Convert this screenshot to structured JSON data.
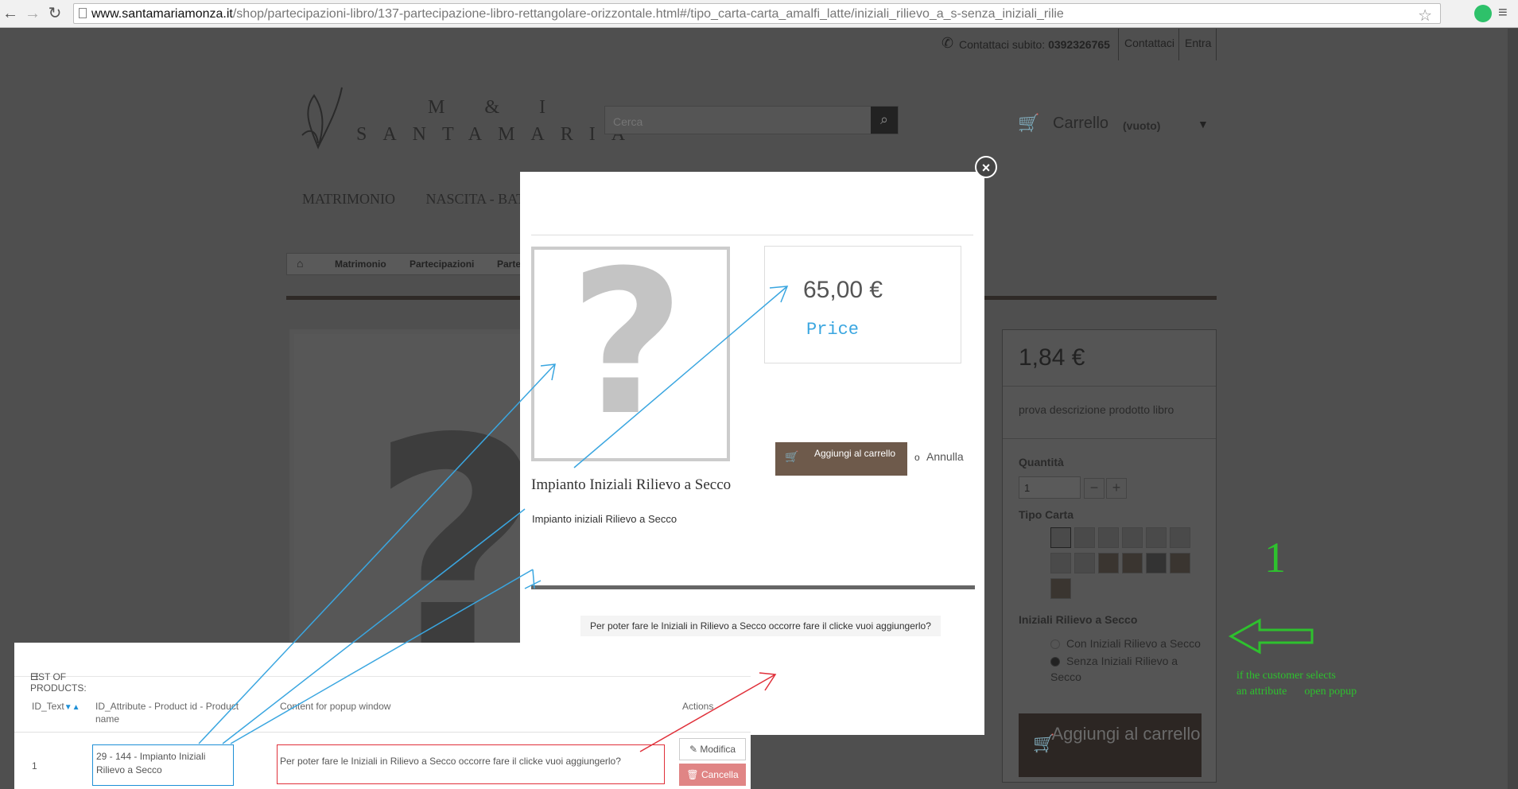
{
  "browser": {
    "url_host": "www.santamariamonza.it",
    "url_path": "/shop/partecipazioni-libro/137-partecipazione-libro-rettangolare-orizzontale.html#/tipo_carta-carta_amalfi_latte/iniziali_rilievo_a_s-senza_iniziali_rilie"
  },
  "topbar": {
    "contact_label": "Contattaci subito:",
    "phone": "0392326765",
    "contact_link": "Contattaci",
    "login_link": "Entra"
  },
  "logo": {
    "line1": "M & I",
    "line2": "SANTAMARIA"
  },
  "search": {
    "placeholder": "Cerca"
  },
  "cart": {
    "label": "Carrello",
    "status": "(vuoto)"
  },
  "menu": {
    "item1": "MATRIMONIO",
    "item2": "NASCITA - BATTE"
  },
  "breadcrumb": {
    "item1": "Matrimonio",
    "item2": "Partecipazioni",
    "item3": "Parte"
  },
  "product": {
    "price": "1,84 €",
    "description": "prova descrizione prodotto libro",
    "qty_label": "Quantità",
    "qty_value": "1",
    "paper_label": "Tipo Carta",
    "initials_label": "Iniziali Rilievo a Secco",
    "option1": "Con Iniziali Rilievo a Secco",
    "option2": "Senza Iniziali Rilievo a Secco",
    "add_button": "Aggiungi al carrello"
  },
  "modal": {
    "price": "65,00 €",
    "price_annotation": "Price",
    "add_button": "Aggiungi al carrello",
    "or_text": "o",
    "cancel_link": "Annulla",
    "title": "Impianto Iniziali Rilievo a Secco",
    "description": "Impianto iniziali Rilievo a Secco",
    "popup_text": "Per poter fare  le Iniziali in  Rilievo a Secco occorre fare il clicke  vuoi aggiungerlo?"
  },
  "annotation": {
    "number": "1",
    "line1": "if the customer selects",
    "line2": "an attribute",
    "line3": "open popup",
    "color": "#2ec12e"
  },
  "admin": {
    "header": "LIST OF PRODUCTS:",
    "col1": "ID_Text",
    "col2": "ID_Attribute - Product id - Product name",
    "col3": "Content for popup window",
    "col4": "Actions",
    "rows": [
      {
        "id": "1",
        "attribute": "29 - 144 - Impianto Iniziali Rilievo a Secco",
        "content": "Per poter fare  le Iniziali in  Rilievo a Secco occorre fare il clicke  vuoi aggiungerlo?"
      }
    ],
    "edit_button": "Modifica",
    "delete_button": "Cancella"
  },
  "colors": {
    "accent": "#6e5a4b",
    "arrow_blue": "#3aa6e0",
    "arrow_red": "#e0303a"
  }
}
